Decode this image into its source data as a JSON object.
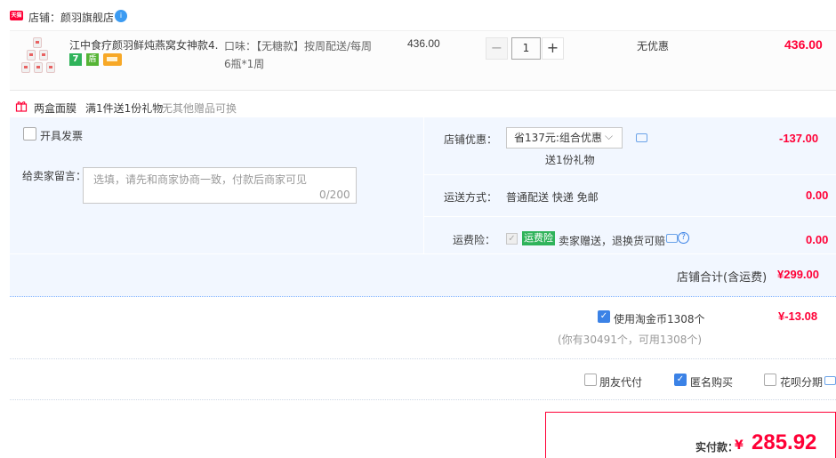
{
  "shop": {
    "badge": "天猫",
    "label": "店铺：颜羽旗舰店",
    "ww": "i"
  },
  "item": {
    "title": "江中食疗颜羽鲜炖燕窝女神款4...",
    "tags": [
      "7",
      "盾",
      "card"
    ],
    "sku_line1": "口味：【无糖款】按周配送/每周",
    "sku_line2": "6瓶*1周",
    "unit_price": "436.00",
    "qty": "1",
    "qty_minus": "−",
    "qty_plus": "+",
    "discount": "无优惠",
    "total": "436.00"
  },
  "gift": {
    "name": "两盒面膜",
    "rule": "满1件送1份礼物",
    "note": "无其他赠品可换"
  },
  "invoice": {
    "label": "开具发票"
  },
  "memo": {
    "label": "给卖家留言：",
    "placeholder": "选填，请先和商家协商一致，付款后商家可见",
    "count": "0/200"
  },
  "shop_discount": {
    "label": "店铺优惠：",
    "selected": "省137元:组合优惠",
    "chevron": "⌵",
    "sub": "送1份礼物",
    "amount": "-137.00"
  },
  "shipping": {
    "label": "运送方式：",
    "value": "普通配送 快递 免邮",
    "amount": "0.00"
  },
  "insurance": {
    "label": "运费险：",
    "check": "✓",
    "badge": "运费险",
    "desc": "卖家赠送，退换货可赔",
    "help": "?",
    "amount": "0.00"
  },
  "shop_total": {
    "label": "店铺合计(含运费)",
    "amount": "¥299.00"
  },
  "coins": {
    "check": "✓",
    "label": "使用淘金币1308个",
    "note": "(你有30491个，可用1308个)",
    "amount": "¥-13.08"
  },
  "options": {
    "friend": "朋友代付",
    "anon": "匿名购买",
    "anon_check": "✓",
    "huabei": "花呗分期"
  },
  "payment": {
    "label": "实付款：",
    "symbol": "¥",
    "amount": "285.92"
  }
}
